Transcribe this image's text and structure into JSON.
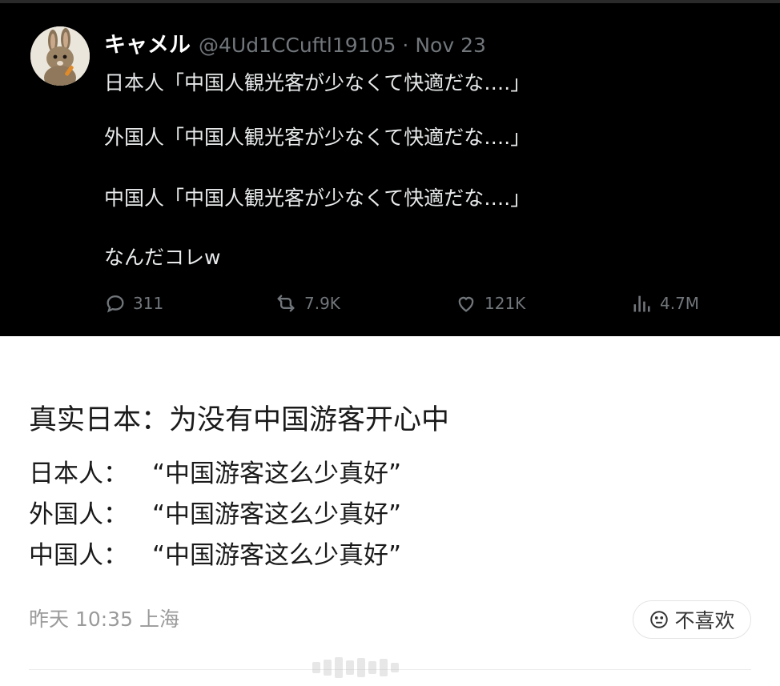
{
  "tweet": {
    "display_name": "キャメル",
    "handle": "@4Ud1CCuftl19105",
    "separator": "·",
    "date": "Nov 23",
    "lines": [
      "日本人「中国人観光客が少なくて快適だな….」",
      "外国人「中国人観光客が少なくて快適だな….」",
      "中国人「中国人観光客が少なくて快適だな….」",
      "なんだコレw"
    ],
    "stats": {
      "replies": "311",
      "reposts": "7.9K",
      "likes": "121K",
      "views": "4.7M"
    }
  },
  "post": {
    "title": "真实日本：为没有中国游客开心中",
    "lines": [
      {
        "speaker": "日本人：",
        "quote": "“中国游客这么少真好”"
      },
      {
        "speaker": "外国人：",
        "quote": "“中国游客这么少真好”"
      },
      {
        "speaker": "中国人：",
        "quote": "“中国游客这么少真好”"
      }
    ],
    "meta": "昨天 10:35 上海",
    "dislike_label": "不喜欢"
  },
  "icons": {
    "avatar": "rabbit-avatar-icon",
    "reply": "reply-icon",
    "repost": "repost-icon",
    "like": "heart-icon",
    "views": "views-icon",
    "dislike": "frown-icon"
  }
}
